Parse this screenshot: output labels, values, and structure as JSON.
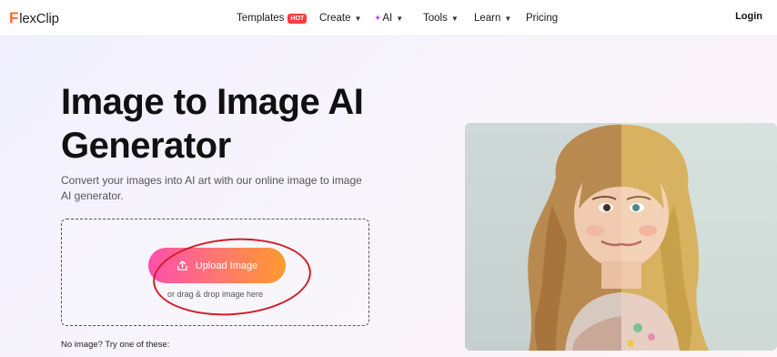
{
  "brand": {
    "logo_initial": "F",
    "logo_rest": "lexClip"
  },
  "nav": {
    "templates": "Templates",
    "hot_badge": "HOT",
    "create": "Create",
    "ai": "AI",
    "tools": "Tools",
    "learn": "Learn",
    "pricing": "Pricing",
    "login": "Login"
  },
  "hero": {
    "title_line1": "Image to Image AI",
    "title_line2": "Generator",
    "description": "Convert your images into AI art with our online image to image AI generator."
  },
  "upload": {
    "button_label": "Upload Image",
    "hint": "or drag & drop image here"
  },
  "samples": {
    "label": "No image? Try one of these:"
  },
  "icons": {
    "upload": "upload-icon",
    "chevron": "chevron-down-icon",
    "sparkle": "sparkle-icon"
  },
  "colors": {
    "logo_accent": "#ff6a2c",
    "hot_badge": "#ff3d3d",
    "upload_gradient_start": "#ff4fae",
    "upload_gradient_end": "#ff9a2e",
    "annotation_circle": "#cf1f2a"
  }
}
